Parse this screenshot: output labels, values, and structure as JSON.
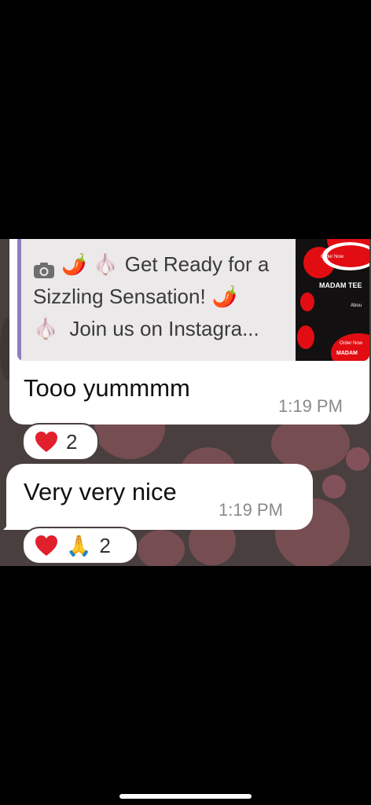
{
  "quoted_message": {
    "line1": "Get Ready for a",
    "line2": "Sizzling Sensation!",
    "line3": "Join us on Instagra..."
  },
  "thumbnail": {
    "brand": "MADAM TEE",
    "order_now": "Order Now",
    "about": "Abou",
    "order_now_2": "Order Now",
    "brand_2": "MADAM"
  },
  "messages": [
    {
      "text": "Tooo yummmm",
      "time": "1:19 PM"
    },
    {
      "text": "Very very nice",
      "time": "1:19 PM"
    }
  ],
  "reactions": [
    {
      "emojis": [
        "heart"
      ],
      "count": "2"
    },
    {
      "emojis": [
        "heart",
        "folded-hands"
      ],
      "count": "2"
    }
  ],
  "colors": {
    "bubble": "#ffffff",
    "quote_bar": "#8d7fc0",
    "heart": "#e0202c",
    "wallpaper": "#4a3f3f"
  }
}
